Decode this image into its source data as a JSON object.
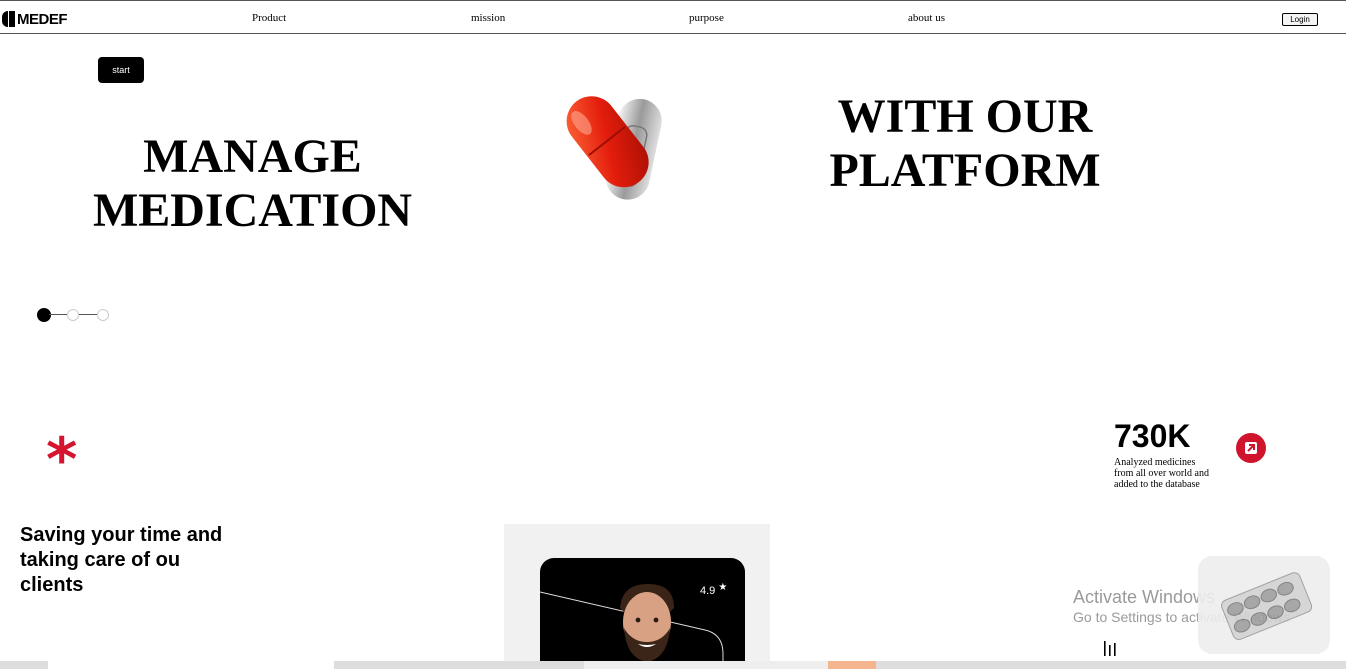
{
  "brand": {
    "name": "MEDEF"
  },
  "nav": {
    "links": [
      "Product",
      "mission",
      "purpose",
      "about us"
    ],
    "login_label": "Login"
  },
  "hero": {
    "start_label": "start",
    "headline_left": "MANAGE MEDICATION",
    "headline_right": "WITH OUR PLATFORM",
    "slider": {
      "count": 3,
      "active_index": 0
    }
  },
  "stats": {
    "value": "730K",
    "description": "Analyzed medicines from all over world and added to the database"
  },
  "tagline": "Saving your time and taking care of ou clients",
  "card": {
    "rating": "4.9"
  },
  "os_overlay": {
    "title": "Activate Windows",
    "subtitle": "Go to Settings to activate Windows."
  },
  "colors": {
    "accent": "#d5152f",
    "primary": "#000000",
    "panel": "#f1f1f1"
  }
}
